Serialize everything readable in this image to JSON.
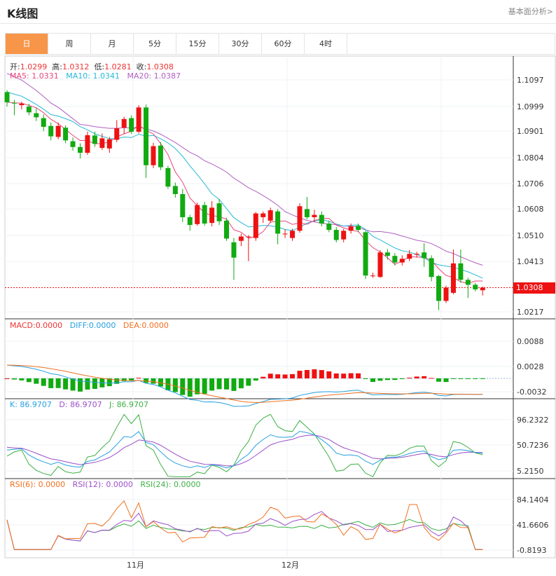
{
  "header": {
    "title": "K线图",
    "fundamental_link": "基本面分析>"
  },
  "tabs": [
    {
      "label": "日",
      "active": true
    },
    {
      "label": "周",
      "active": false
    },
    {
      "label": "月",
      "active": false
    },
    {
      "label": "5分",
      "active": false
    },
    {
      "label": "15分",
      "active": false
    },
    {
      "label": "30分",
      "active": false
    },
    {
      "label": "60分",
      "active": false
    },
    {
      "label": "4时",
      "active": false
    }
  ],
  "ohlc": {
    "open_label": "开:",
    "open": "1.0299",
    "high_label": "高:",
    "high": "1.0312",
    "low_label": "低:",
    "low": "1.0281",
    "close_label": "收:",
    "close": "1.0308"
  },
  "ma": {
    "ma5_label": "MA5:",
    "ma5": "1.0331",
    "ma10_label": "MA10:",
    "ma10": "1.0341",
    "ma20_label": "MA20:",
    "ma20": "1.0387"
  },
  "macd": {
    "macd_label": "MACD:",
    "macd": "0.0000",
    "diff_label": "DIFF:",
    "diff": "0.0000",
    "dea_label": "DEA:",
    "dea": "0.0000"
  },
  "kdj": {
    "k_label": "K:",
    "k": "86.9707",
    "d_label": "D:",
    "d": "86.9707",
    "j_label": "J:",
    "j": "86.9707"
  },
  "rsi": {
    "r6_label": "RSI(6):",
    "r6": "0.0000",
    "r12_label": "RSI(12):",
    "r12": "0.0000",
    "r24_label": "RSI(24):",
    "r24": "0.0000"
  },
  "axes": {
    "price_ticks": [
      "1.1097",
      "1.0999",
      "1.0901",
      "1.0804",
      "1.0706",
      "1.0608",
      "1.0510",
      "1.0413",
      "1.0217"
    ],
    "last_price": "1.0308",
    "macd_ticks": [
      "0.0088",
      "0.0028",
      "-0.0032"
    ],
    "kdj_ticks": [
      "96.2322",
      "50.7236",
      "5.2150"
    ],
    "rsi_ticks": [
      "84.1404",
      "41.6606",
      "-0.8193"
    ],
    "x_labels": [
      "11月",
      "12月"
    ]
  },
  "colors": {
    "up": "#ee1111",
    "down": "#11aa11",
    "ma5": "#e8467c",
    "ma10": "#26b8d6",
    "ma20": "#b05fc0",
    "accent": "#f79548"
  },
  "chart_data": {
    "type": "candlestick",
    "price_ylim": [
      1.0217,
      1.1097
    ],
    "candles": [
      {
        "o": 1.0985,
        "h": 1.0992,
        "l": 1.0935,
        "c": 1.095
      },
      {
        "o": 1.0948,
        "h": 1.0958,
        "l": 1.0905,
        "c": 1.0946
      },
      {
        "o": 1.094,
        "h": 1.0952,
        "l": 1.0925,
        "c": 1.0945
      },
      {
        "o": 1.0935,
        "h": 1.0945,
        "l": 1.0905,
        "c": 1.0915
      },
      {
        "o": 1.0912,
        "h": 1.093,
        "l": 1.0885,
        "c": 1.0898
      },
      {
        "o": 1.0895,
        "h": 1.0908,
        "l": 1.085,
        "c": 1.0865
      },
      {
        "o": 1.0868,
        "h": 1.088,
        "l": 1.0818,
        "c": 1.0832
      },
      {
        "o": 1.083,
        "h": 1.088,
        "l": 1.0822,
        "c": 1.0868
      },
      {
        "o": 1.0862,
        "h": 1.087,
        "l": 1.0808,
        "c": 1.0818
      },
      {
        "o": 1.0815,
        "h": 1.0828,
        "l": 1.0782,
        "c": 1.0795
      },
      {
        "o": 1.0795,
        "h": 1.0808,
        "l": 1.0755,
        "c": 1.0775
      },
      {
        "o": 1.0775,
        "h": 1.0848,
        "l": 1.0768,
        "c": 1.0836
      },
      {
        "o": 1.0835,
        "h": 1.0848,
        "l": 1.0795,
        "c": 1.0806
      },
      {
        "o": 1.0792,
        "h": 1.0842,
        "l": 1.0785,
        "c": 1.0825
      },
      {
        "o": 1.079,
        "h": 1.083,
        "l": 1.0775,
        "c": 1.0822
      },
      {
        "o": 1.082,
        "h": 1.0888,
        "l": 1.0812,
        "c": 1.086
      },
      {
        "o": 1.0862,
        "h": 1.09,
        "l": 1.084,
        "c": 1.0892
      },
      {
        "o": 1.0895,
        "h": 1.0905,
        "l": 1.084,
        "c": 1.0848
      },
      {
        "o": 1.0848,
        "h": 1.094,
        "l": 1.0842,
        "c": 1.0932
      },
      {
        "o": 1.0932,
        "h": 1.0942,
        "l": 1.0688,
        "c": 1.0732
      },
      {
        "o": 1.0732,
        "h": 1.081,
        "l": 1.0722,
        "c": 1.0798
      },
      {
        "o": 1.08,
        "h": 1.0812,
        "l": 1.0715,
        "c": 1.0725
      },
      {
        "o": 1.0722,
        "h": 1.073,
        "l": 1.065,
        "c": 1.0658
      },
      {
        "o": 1.066,
        "h": 1.0672,
        "l": 1.062,
        "c": 1.0632
      },
      {
        "o": 1.0632,
        "h": 1.065,
        "l": 1.0535,
        "c": 1.0552
      },
      {
        "o": 1.0552,
        "h": 1.056,
        "l": 1.0505,
        "c": 1.0525
      },
      {
        "o": 1.0528,
        "h": 1.0602,
        "l": 1.0522,
        "c": 1.0594
      },
      {
        "o": 1.0594,
        "h": 1.0605,
        "l": 1.0522,
        "c": 1.053
      },
      {
        "o": 1.0532,
        "h": 1.0608,
        "l": 1.052,
        "c": 1.0585
      },
      {
        "o": 1.06,
        "h": 1.0615,
        "l": 1.0525,
        "c": 1.0538
      },
      {
        "o": 1.054,
        "h": 1.055,
        "l": 1.047,
        "c": 1.0478
      },
      {
        "o": 1.0465,
        "h": 1.048,
        "l": 1.0335,
        "c": 1.0412
      },
      {
        "o": 1.047,
        "h": 1.0495,
        "l": 1.0452,
        "c": 1.0485
      },
      {
        "o": 1.0485,
        "h": 1.049,
        "l": 1.04,
        "c": 1.0485
      },
      {
        "o": 1.048,
        "h": 1.057,
        "l": 1.047,
        "c": 1.0565
      },
      {
        "o": 1.0552,
        "h": 1.0572,
        "l": 1.0532,
        "c": 1.0565
      },
      {
        "o": 1.054,
        "h": 1.0585,
        "l": 1.0532,
        "c": 1.0576
      },
      {
        "o": 1.0572,
        "h": 1.058,
        "l": 1.0458,
        "c": 1.0495
      },
      {
        "o": 1.0493,
        "h": 1.051,
        "l": 1.048,
        "c": 1.0495
      },
      {
        "o": 1.048,
        "h": 1.0512,
        "l": 1.047,
        "c": 1.0505
      },
      {
        "o": 1.0505,
        "h": 1.06,
        "l": 1.0498,
        "c": 1.059
      },
      {
        "o": 1.058,
        "h": 1.0622,
        "l": 1.0545,
        "c": 1.0552
      },
      {
        "o": 1.0552,
        "h": 1.0578,
        "l": 1.0535,
        "c": 1.056
      },
      {
        "o": 1.056,
        "h": 1.0572,
        "l": 1.052,
        "c": 1.053
      },
      {
        "o": 1.053,
        "h": 1.054,
        "l": 1.05,
        "c": 1.0508
      },
      {
        "o": 1.0508,
        "h": 1.0518,
        "l": 1.0465,
        "c": 1.0473
      },
      {
        "o": 1.0475,
        "h": 1.0512,
        "l": 1.0465,
        "c": 1.0505
      },
      {
        "o": 1.0505,
        "h": 1.053,
        "l": 1.0495,
        "c": 1.052
      },
      {
        "o": 1.0522,
        "h": 1.053,
        "l": 1.05,
        "c": 1.0508
      },
      {
        "o": 1.05,
        "h": 1.0505,
        "l": 1.0338,
        "c": 1.035
      },
      {
        "o": 1.035,
        "h": 1.036,
        "l": 1.0342,
        "c": 1.035
      },
      {
        "o": 1.0345,
        "h": 1.0438,
        "l": 1.0342,
        "c": 1.043
      },
      {
        "o": 1.043,
        "h": 1.0442,
        "l": 1.0405,
        "c": 1.0418
      },
      {
        "o": 1.0418,
        "h": 1.0428,
        "l": 1.0385,
        "c": 1.0395
      },
      {
        "o": 1.0395,
        "h": 1.042,
        "l": 1.0385,
        "c": 1.0408
      },
      {
        "o": 1.0408,
        "h": 1.0438,
        "l": 1.04,
        "c": 1.0425
      },
      {
        "o": 1.0422,
        "h": 1.0432,
        "l": 1.0412,
        "c": 1.0425
      },
      {
        "o": 1.043,
        "h": 1.0462,
        "l": 1.038,
        "c": 1.041
      },
      {
        "o": 1.041,
        "h": 1.042,
        "l": 1.033,
        "c": 1.0345
      },
      {
        "o": 1.0348,
        "h": 1.0352,
        "l": 1.023,
        "c": 1.0262
      },
      {
        "o": 1.0262,
        "h": 1.0315,
        "l": 1.0255,
        "c": 1.0308
      },
      {
        "o": 1.029,
        "h": 1.044,
        "l": 1.0285,
        "c": 1.0392
      },
      {
        "o": 1.0392,
        "h": 1.044,
        "l": 1.0325,
        "c": 1.0335
      },
      {
        "o": 1.0335,
        "h": 1.0342,
        "l": 1.0272,
        "c": 1.0318
      },
      {
        "o": 1.0318,
        "h": 1.0325,
        "l": 1.0295,
        "c": 1.0302
      },
      {
        "o": 1.0299,
        "h": 1.0312,
        "l": 1.0281,
        "c": 1.0308
      }
    ]
  }
}
